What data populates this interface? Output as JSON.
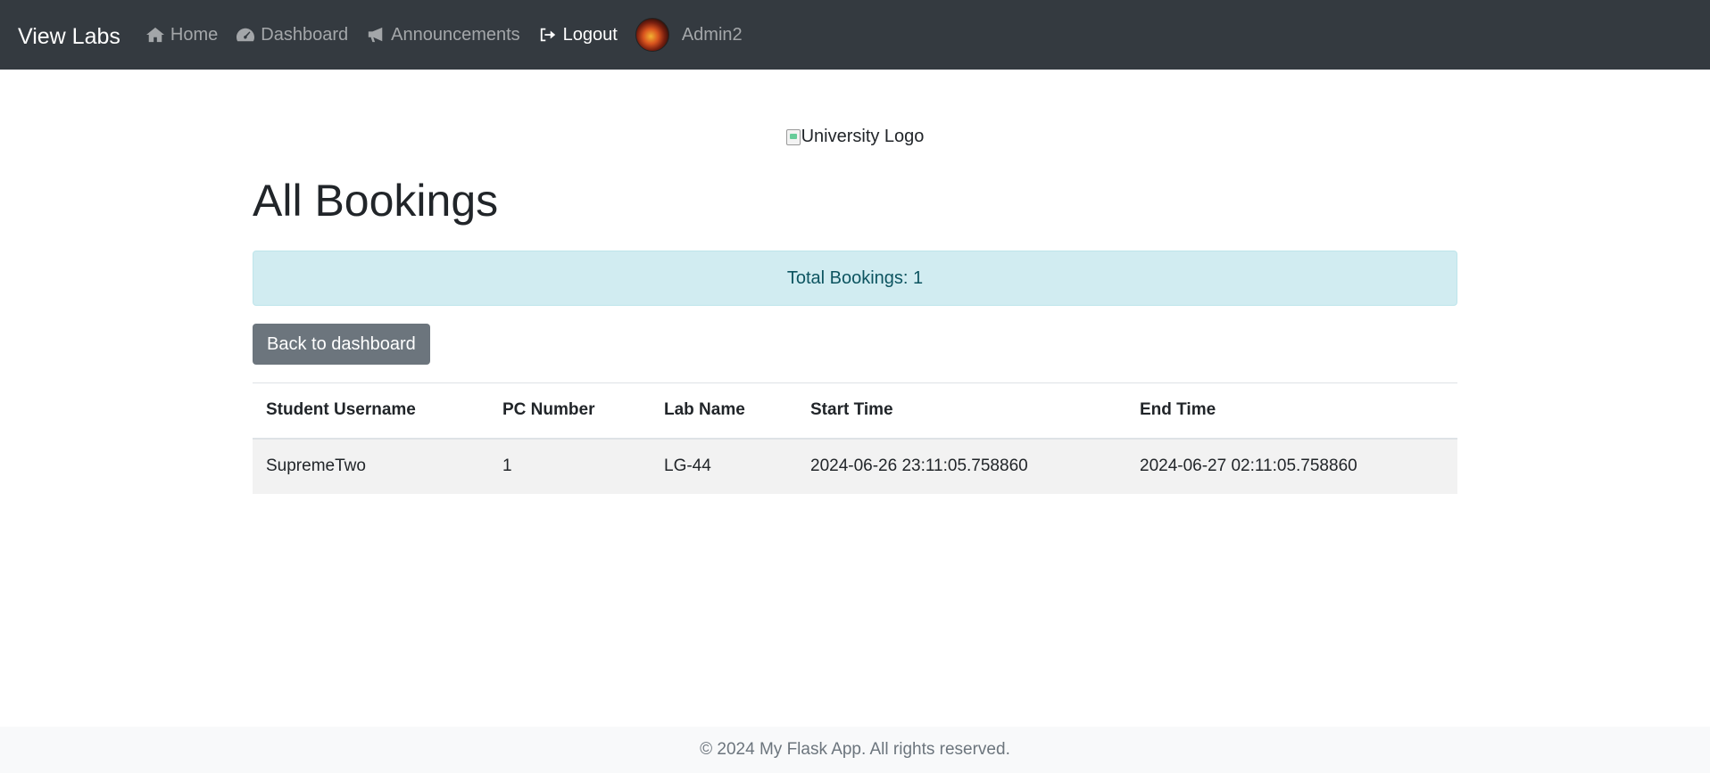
{
  "nav": {
    "brand": "View Labs",
    "links": [
      {
        "label": "Home",
        "icon": "home-icon"
      },
      {
        "label": "Dashboard",
        "icon": "dashboard-icon"
      },
      {
        "label": "Announcements",
        "icon": "megaphone-icon"
      },
      {
        "label": "Logout",
        "icon": "logout-icon"
      }
    ],
    "user": "Admin2"
  },
  "main": {
    "logo_alt": "University Logo",
    "title": "All Bookings",
    "total_label": "Total Bookings: 1",
    "back_button": "Back to dashboard",
    "table": {
      "headers": [
        "Student Username",
        "PC Number",
        "Lab Name",
        "Start Time",
        "End Time"
      ],
      "rows": [
        [
          "SupremeTwo",
          "1",
          "LG-44",
          "2024-06-26 23:11:05.758860",
          "2024-06-27 02:11:05.758860"
        ]
      ]
    }
  },
  "footer": {
    "text": "© 2024 My Flask App. All rights reserved."
  },
  "colors": {
    "navbar": "#343a40",
    "alert_bg": "#d1ecf1",
    "alert_text": "#0c5460",
    "button": "#6c757d",
    "row_stripe": "#f2f2f2"
  }
}
